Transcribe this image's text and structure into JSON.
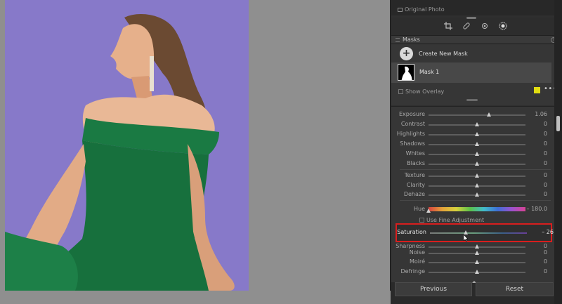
{
  "panel": {
    "original_photo_label": "Original Photo",
    "masks": {
      "title": "Masks",
      "create_label": "Create New Mask",
      "items": [
        {
          "label": "Mask 1"
        }
      ],
      "show_overlay_label": "Show Overlay",
      "overlay_color": "#e1dd12"
    },
    "adjustments": {
      "exposure": {
        "label": "Exposure",
        "value": "1.06",
        "position": 0.62
      },
      "contrast": {
        "label": "Contrast",
        "value": "0",
        "position": 0.5
      },
      "highlights": {
        "label": "Highlights",
        "value": "0",
        "position": 0.5
      },
      "shadows": {
        "label": "Shadows",
        "value": "0",
        "position": 0.5
      },
      "whites": {
        "label": "Whites",
        "value": "0",
        "position": 0.5
      },
      "blacks": {
        "label": "Blacks",
        "value": "0",
        "position": 0.5
      },
      "texture": {
        "label": "Texture",
        "value": "0",
        "position": 0.5
      },
      "clarity": {
        "label": "Clarity",
        "value": "0",
        "position": 0.5
      },
      "dehaze": {
        "label": "Dehaze",
        "value": "0",
        "position": 0.5
      },
      "hue": {
        "label": "Hue",
        "value": "– 180.0",
        "position": 0.0
      },
      "use_fine_adjustment": "Use Fine Adjustment",
      "saturation": {
        "label": "Saturation",
        "value": "– 26",
        "position": 0.37
      },
      "sharpness": {
        "label": "Sharpness",
        "value": "0",
        "position": 0.5
      },
      "noise": {
        "label": "Noise",
        "value": "0",
        "position": 0.5
      },
      "moire": {
        "label": "Moiré",
        "value": "0",
        "position": 0.5
      },
      "defringe": {
        "label": "Defringe",
        "value": "0",
        "position": 0.5
      }
    },
    "footer": {
      "previous_label": "Previous",
      "reset_label": "Reset"
    }
  },
  "colors": {
    "backdrop": "#8779c9",
    "dress": "#1a7a43",
    "highlight_box": "#d81e1e"
  }
}
